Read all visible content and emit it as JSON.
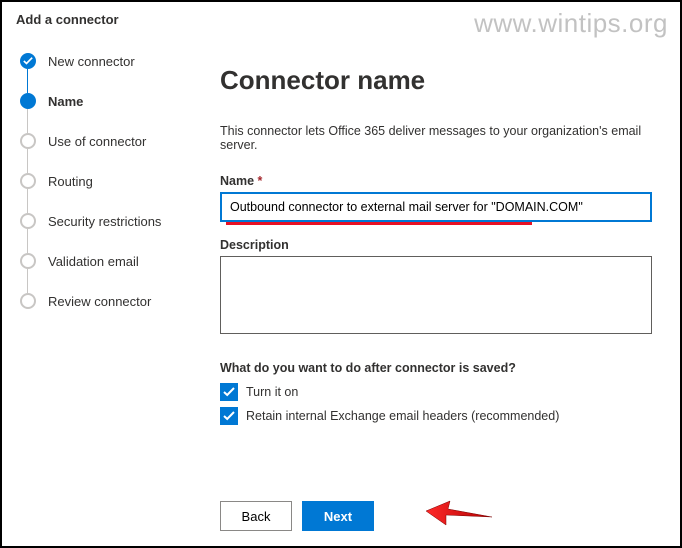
{
  "header": {
    "title": "Add a connector"
  },
  "watermark": "www.wintips.org",
  "sidebar": {
    "steps": [
      {
        "label": "New connector",
        "state": "done"
      },
      {
        "label": "Name",
        "state": "current"
      },
      {
        "label": "Use of connector",
        "state": "pending"
      },
      {
        "label": "Routing",
        "state": "pending"
      },
      {
        "label": "Security restrictions",
        "state": "pending"
      },
      {
        "label": "Validation email",
        "state": "pending"
      },
      {
        "label": "Review connector",
        "state": "pending"
      }
    ]
  },
  "main": {
    "title": "Connector name",
    "intro": "This connector lets Office 365 deliver messages to your organization's email server.",
    "name_label": "Name",
    "name_required_mark": "*",
    "name_value": "Outbound connector to external mail server for \"DOMAIN.COM\"",
    "description_label": "Description",
    "description_value": "",
    "after_save_question": "What do you want to do after connector is saved?",
    "checkboxes": [
      {
        "label": "Turn it on",
        "checked": true
      },
      {
        "label": "Retain internal Exchange email headers (recommended)",
        "checked": true
      }
    ]
  },
  "footer": {
    "back": "Back",
    "next": "Next"
  }
}
